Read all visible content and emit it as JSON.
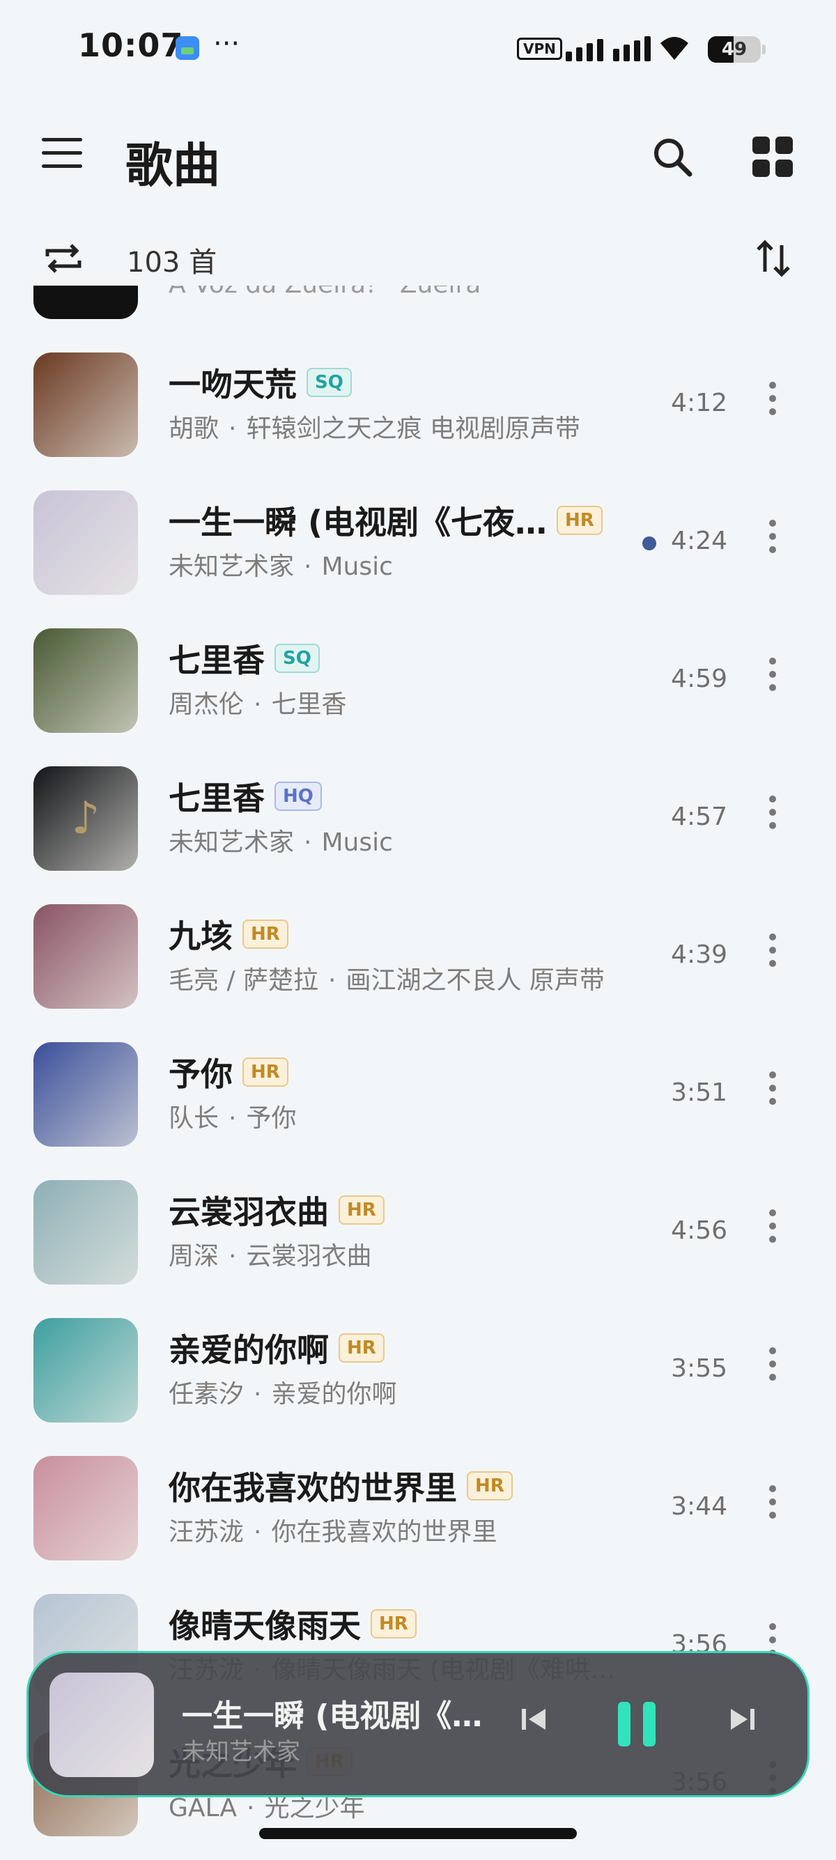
{
  "status_bar": {
    "time": "10:07",
    "dots": "···",
    "vpn": "VPN",
    "battery": "49",
    "battery_level": 0.49
  },
  "header": {
    "title": "歌曲"
  },
  "subbar": {
    "count": "103 首"
  },
  "partial_row": {
    "subtitle": "A Voz da Zueira! · Zueira"
  },
  "songs": [
    {
      "title": "一吻天荒",
      "badge": "SQ",
      "artist": "胡歌",
      "album": "轩辕剑之天之痕 电视剧原声带",
      "duration": "4:12",
      "cover": "#6b3a22"
    },
    {
      "title": "一生一瞬 (电视剧《七夜…",
      "badge": "HR",
      "artist": "未知艺术家",
      "album": "Music",
      "duration": "4:24",
      "playing": true,
      "cover": "#c9c3d8"
    },
    {
      "title": "七里香",
      "badge": "SQ",
      "artist": "周杰伦",
      "album": "七里香",
      "duration": "4:59",
      "cover": "#4a5a34"
    },
    {
      "title": "七里香",
      "badge": "HQ",
      "artist": "未知艺术家",
      "album": "Music",
      "duration": "4:57",
      "cover": "#121418",
      "note": "♪"
    },
    {
      "title": "九垓",
      "badge": "HR",
      "artist": "毛亮 / 萨楚拉",
      "album": "画江湖之不良人 原声带",
      "duration": "4:39",
      "cover": "#8a5466"
    },
    {
      "title": "予你",
      "badge": "HR",
      "artist": "队长",
      "album": "予你",
      "duration": "3:51",
      "cover": "#3a4f9a"
    },
    {
      "title": "云裳羽衣曲",
      "badge": "HR",
      "artist": "周深",
      "album": "云裳羽衣曲",
      "duration": "4:56",
      "cover": "#8eb0b7"
    },
    {
      "title": "亲爱的你啊",
      "badge": "HR",
      "artist": "任素汐",
      "album": "亲爱的你啊",
      "duration": "3:55",
      "cover": "#3e9fa0"
    },
    {
      "title": "你在我喜欢的世界里",
      "badge": "HR",
      "artist": "汪苏泷",
      "album": "你在我喜欢的世界里",
      "duration": "3:44",
      "cover": "#c98f9d"
    },
    {
      "title": "像晴天像雨天",
      "badge": "HR",
      "artist": "汪苏泷",
      "album": "像晴天像雨天 (电视剧《难哄…",
      "duration": "3:56",
      "cover": "#b5c4d4"
    },
    {
      "title": "光之少年",
      "badge": "HR",
      "artist": "GALA",
      "album": "光之少年",
      "duration": "3:56",
      "cover": "#8d6a52"
    }
  ],
  "player": {
    "title": "一生一瞬 (电视剧《…",
    "artist": "未知艺术家",
    "cover": "#c9c3d8"
  }
}
